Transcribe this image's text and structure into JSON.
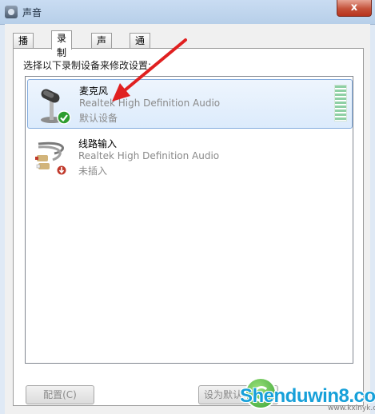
{
  "window": {
    "title": "声音",
    "close_label": "x"
  },
  "tabs": [
    {
      "label": "播放"
    },
    {
      "label": "录制"
    },
    {
      "label": "声音"
    },
    {
      "label": "通信"
    }
  ],
  "active_tab": "录制",
  "instruction": "选择以下录制设备来修改设置:",
  "devices": [
    {
      "name": "麦克风",
      "description": "Realtek High Definition Audio",
      "status": "默认设备",
      "icon": "microphone-icon",
      "badge": "default-check-icon",
      "selected": true
    },
    {
      "name": "线路输入",
      "description": "Realtek High Definition Audio",
      "status": "未插入",
      "icon": "rca-cable-icon",
      "badge": "unplugged-icon",
      "selected": false
    }
  ],
  "buttons": {
    "configure": "配置(C)",
    "set_default": "设为默认"
  },
  "watermark": {
    "text": "Shenduwin8.com",
    "sub": "www.kxinyk.com"
  },
  "colors": {
    "selection": "#dcebfc",
    "arrow": "#e02020",
    "default_badge": "#2e9d2e"
  }
}
